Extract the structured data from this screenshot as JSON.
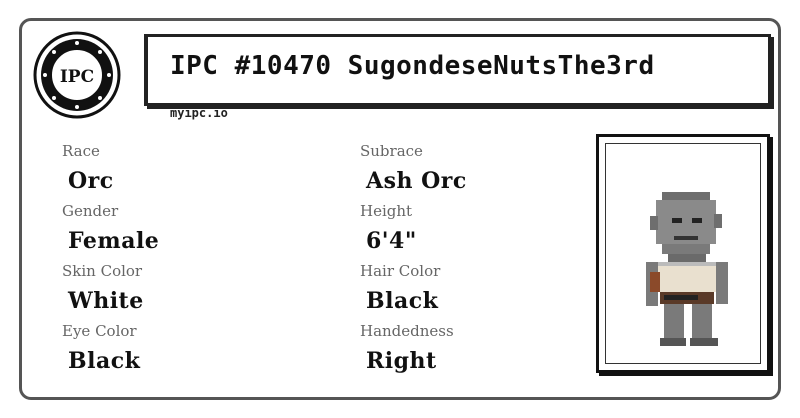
{
  "card": {
    "title": "IPC #10470 SugondeseNutsThe3rd",
    "site": "myipc.io",
    "logo_text": "IPC"
  },
  "fields": [
    {
      "label": "Race",
      "value": "Orc"
    },
    {
      "label": "Subrace",
      "value": "Ash Orc"
    },
    {
      "label": "Gender",
      "value": "Female"
    },
    {
      "label": "Height",
      "value": "6'4\""
    },
    {
      "label": "Skin Color",
      "value": "White"
    },
    {
      "label": "Hair Color",
      "value": "Black"
    },
    {
      "label": "Eye Color",
      "value": "Black"
    },
    {
      "label": "Handedness",
      "value": "Right"
    }
  ],
  "portrait": {
    "icon": "orc-character-sprite"
  }
}
